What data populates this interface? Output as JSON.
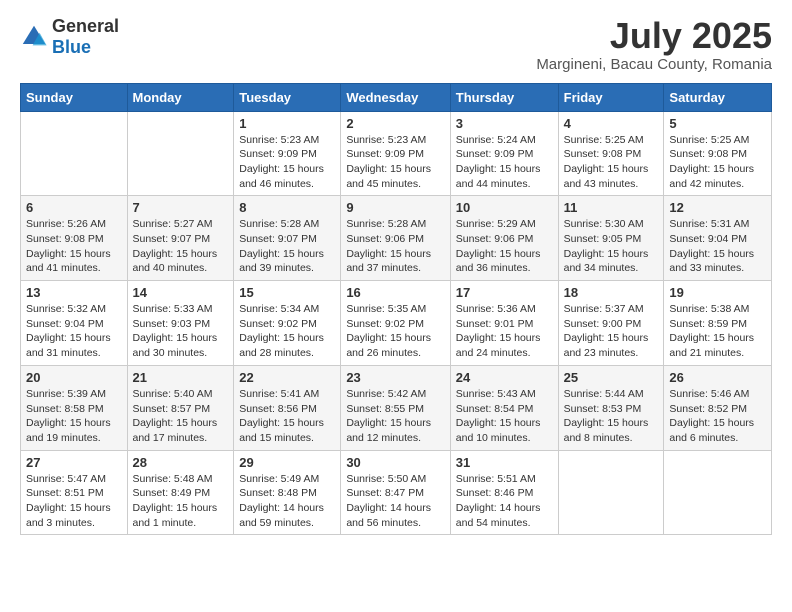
{
  "logo": {
    "general": "General",
    "blue": "Blue"
  },
  "title": "July 2025",
  "location": "Margineni, Bacau County, Romania",
  "weekdays": [
    "Sunday",
    "Monday",
    "Tuesday",
    "Wednesday",
    "Thursday",
    "Friday",
    "Saturday"
  ],
  "weeks": [
    [
      {
        "day": "",
        "info": ""
      },
      {
        "day": "",
        "info": ""
      },
      {
        "day": "1",
        "info": "Sunrise: 5:23 AM\nSunset: 9:09 PM\nDaylight: 15 hours and 46 minutes."
      },
      {
        "day": "2",
        "info": "Sunrise: 5:23 AM\nSunset: 9:09 PM\nDaylight: 15 hours and 45 minutes."
      },
      {
        "day": "3",
        "info": "Sunrise: 5:24 AM\nSunset: 9:09 PM\nDaylight: 15 hours and 44 minutes."
      },
      {
        "day": "4",
        "info": "Sunrise: 5:25 AM\nSunset: 9:08 PM\nDaylight: 15 hours and 43 minutes."
      },
      {
        "day": "5",
        "info": "Sunrise: 5:25 AM\nSunset: 9:08 PM\nDaylight: 15 hours and 42 minutes."
      }
    ],
    [
      {
        "day": "6",
        "info": "Sunrise: 5:26 AM\nSunset: 9:08 PM\nDaylight: 15 hours and 41 minutes."
      },
      {
        "day": "7",
        "info": "Sunrise: 5:27 AM\nSunset: 9:07 PM\nDaylight: 15 hours and 40 minutes."
      },
      {
        "day": "8",
        "info": "Sunrise: 5:28 AM\nSunset: 9:07 PM\nDaylight: 15 hours and 39 minutes."
      },
      {
        "day": "9",
        "info": "Sunrise: 5:28 AM\nSunset: 9:06 PM\nDaylight: 15 hours and 37 minutes."
      },
      {
        "day": "10",
        "info": "Sunrise: 5:29 AM\nSunset: 9:06 PM\nDaylight: 15 hours and 36 minutes."
      },
      {
        "day": "11",
        "info": "Sunrise: 5:30 AM\nSunset: 9:05 PM\nDaylight: 15 hours and 34 minutes."
      },
      {
        "day": "12",
        "info": "Sunrise: 5:31 AM\nSunset: 9:04 PM\nDaylight: 15 hours and 33 minutes."
      }
    ],
    [
      {
        "day": "13",
        "info": "Sunrise: 5:32 AM\nSunset: 9:04 PM\nDaylight: 15 hours and 31 minutes."
      },
      {
        "day": "14",
        "info": "Sunrise: 5:33 AM\nSunset: 9:03 PM\nDaylight: 15 hours and 30 minutes."
      },
      {
        "day": "15",
        "info": "Sunrise: 5:34 AM\nSunset: 9:02 PM\nDaylight: 15 hours and 28 minutes."
      },
      {
        "day": "16",
        "info": "Sunrise: 5:35 AM\nSunset: 9:02 PM\nDaylight: 15 hours and 26 minutes."
      },
      {
        "day": "17",
        "info": "Sunrise: 5:36 AM\nSunset: 9:01 PM\nDaylight: 15 hours and 24 minutes."
      },
      {
        "day": "18",
        "info": "Sunrise: 5:37 AM\nSunset: 9:00 PM\nDaylight: 15 hours and 23 minutes."
      },
      {
        "day": "19",
        "info": "Sunrise: 5:38 AM\nSunset: 8:59 PM\nDaylight: 15 hours and 21 minutes."
      }
    ],
    [
      {
        "day": "20",
        "info": "Sunrise: 5:39 AM\nSunset: 8:58 PM\nDaylight: 15 hours and 19 minutes."
      },
      {
        "day": "21",
        "info": "Sunrise: 5:40 AM\nSunset: 8:57 PM\nDaylight: 15 hours and 17 minutes."
      },
      {
        "day": "22",
        "info": "Sunrise: 5:41 AM\nSunset: 8:56 PM\nDaylight: 15 hours and 15 minutes."
      },
      {
        "day": "23",
        "info": "Sunrise: 5:42 AM\nSunset: 8:55 PM\nDaylight: 15 hours and 12 minutes."
      },
      {
        "day": "24",
        "info": "Sunrise: 5:43 AM\nSunset: 8:54 PM\nDaylight: 15 hours and 10 minutes."
      },
      {
        "day": "25",
        "info": "Sunrise: 5:44 AM\nSunset: 8:53 PM\nDaylight: 15 hours and 8 minutes."
      },
      {
        "day": "26",
        "info": "Sunrise: 5:46 AM\nSunset: 8:52 PM\nDaylight: 15 hours and 6 minutes."
      }
    ],
    [
      {
        "day": "27",
        "info": "Sunrise: 5:47 AM\nSunset: 8:51 PM\nDaylight: 15 hours and 3 minutes."
      },
      {
        "day": "28",
        "info": "Sunrise: 5:48 AM\nSunset: 8:49 PM\nDaylight: 15 hours and 1 minute."
      },
      {
        "day": "29",
        "info": "Sunrise: 5:49 AM\nSunset: 8:48 PM\nDaylight: 14 hours and 59 minutes."
      },
      {
        "day": "30",
        "info": "Sunrise: 5:50 AM\nSunset: 8:47 PM\nDaylight: 14 hours and 56 minutes."
      },
      {
        "day": "31",
        "info": "Sunrise: 5:51 AM\nSunset: 8:46 PM\nDaylight: 14 hours and 54 minutes."
      },
      {
        "day": "",
        "info": ""
      },
      {
        "day": "",
        "info": ""
      }
    ]
  ]
}
